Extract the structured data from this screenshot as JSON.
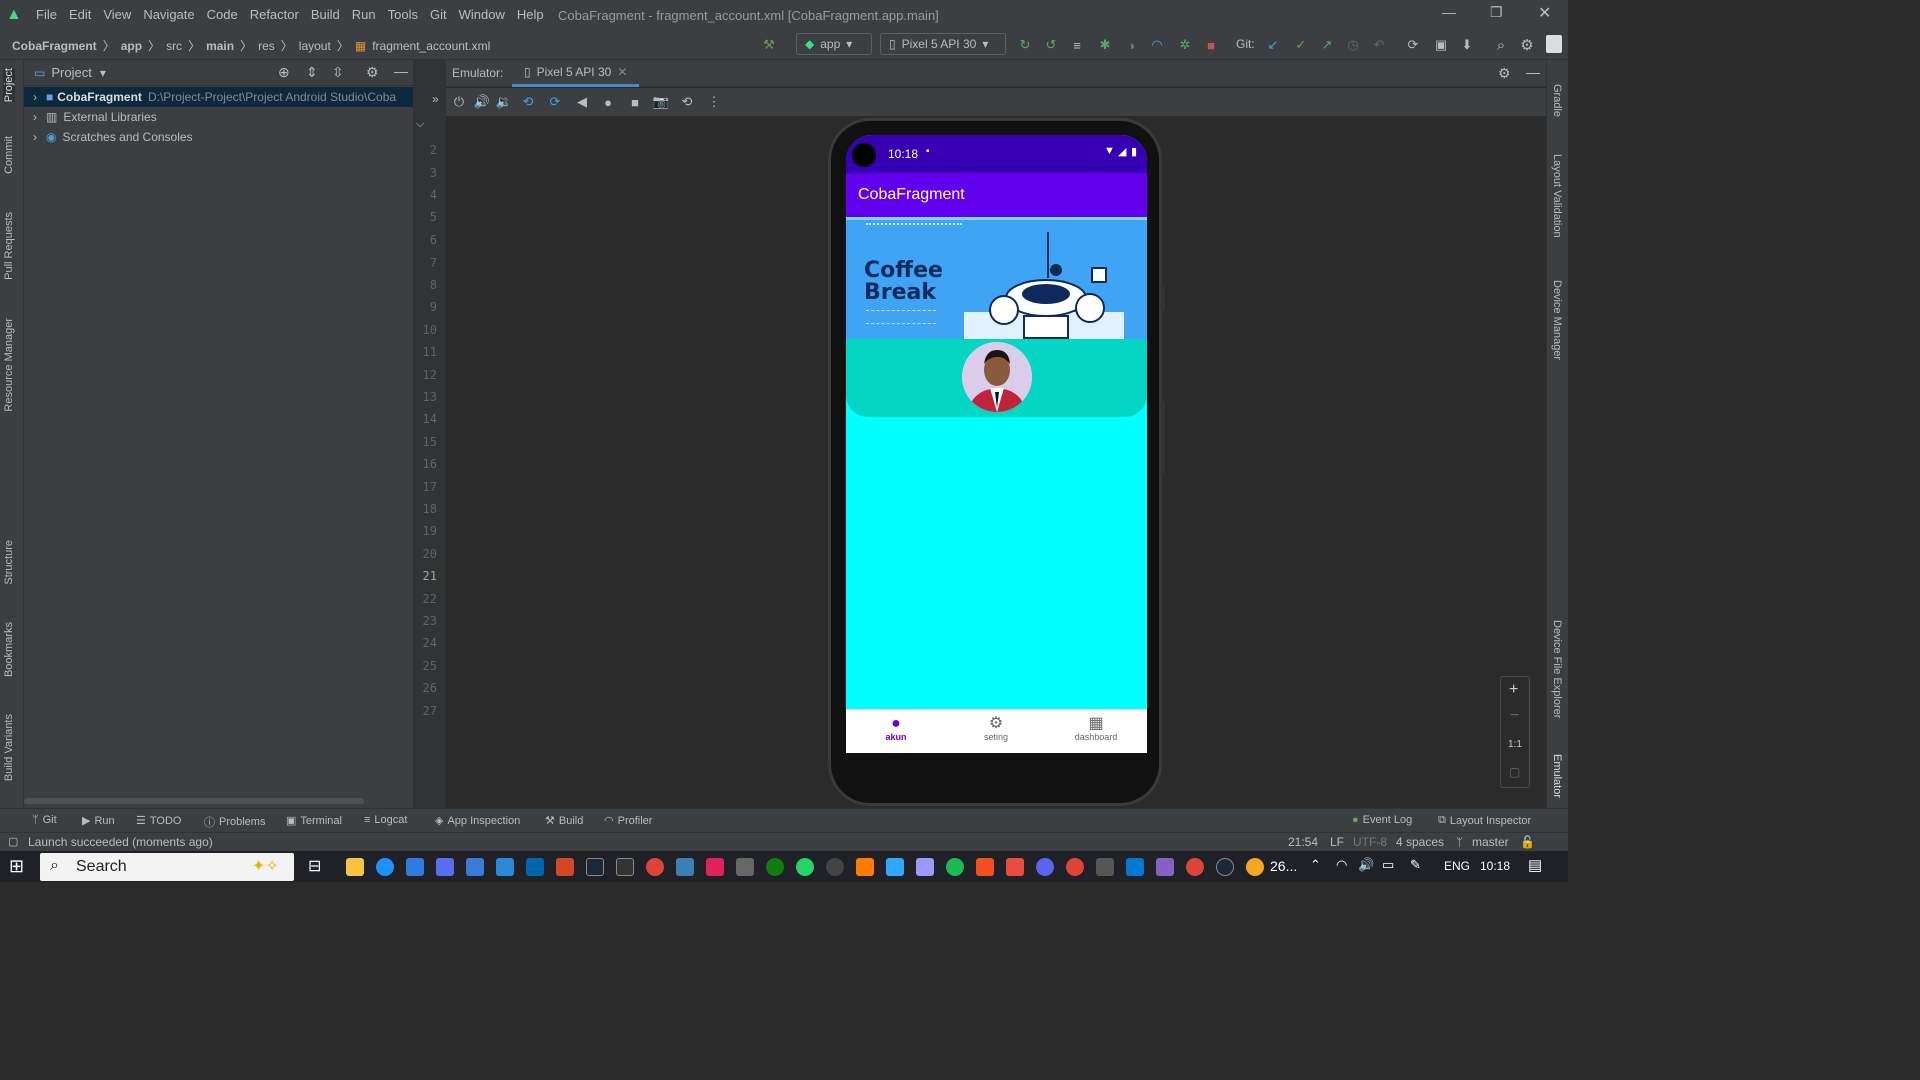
{
  "window": {
    "title": "CobaFragment - fragment_account.xml [CobaFragment.app.main]",
    "menu": [
      "File",
      "Edit",
      "View",
      "Navigate",
      "Code",
      "Refactor",
      "Build",
      "Run",
      "Tools",
      "Git",
      "Window",
      "Help"
    ]
  },
  "breadcrumb": [
    "CobaFragment",
    "app",
    "src",
    "main",
    "res",
    "layout",
    "fragment_account.xml"
  ],
  "toolbar": {
    "run_config": "app",
    "device": "Pixel 5 API 30",
    "git_label": "Git:"
  },
  "project_panel": {
    "title": "Project",
    "items": [
      {
        "label": "CobaFragment",
        "path": "D:\\Project-Project\\Project Android Studio\\Coba"
      },
      {
        "label": "External Libraries"
      },
      {
        "label": "Scratches and Consoles"
      }
    ]
  },
  "left_tabs": [
    "Project",
    "Commit",
    "Pull Requests",
    "Resource Manager",
    "Structure",
    "Bookmarks",
    "Build Variants"
  ],
  "right_tabs": [
    "Gradle",
    "Layout Validation",
    "Device Manager",
    "Device File Explorer",
    "Emulator"
  ],
  "gutter_lines": [
    "2",
    "3",
    "4",
    "5",
    "6",
    "7",
    "8",
    "9",
    "10",
    "11",
    "12",
    "13",
    "14",
    "15",
    "16",
    "17",
    "18",
    "19",
    "20",
    "21",
    "22",
    "23",
    "24",
    "25",
    "26",
    "27"
  ],
  "emulator": {
    "label": "Emulator:",
    "tab": "Pixel 5 API 30",
    "zoom_ratio": "1:1"
  },
  "phone": {
    "time": "10:18",
    "app_title": "CobaFragment",
    "banner_line1": "Coffee",
    "banner_line2": "Break",
    "nav": [
      {
        "label": "akun",
        "icon": "account-circle-icon",
        "active": true
      },
      {
        "label": "seting",
        "icon": "gear-icon",
        "active": false
      },
      {
        "label": "dashboard",
        "icon": "dashboard-icon",
        "active": false
      }
    ]
  },
  "bottom_tools": [
    "Git",
    "Run",
    "TODO",
    "Problems",
    "Terminal",
    "Logcat",
    "App Inspection",
    "Build",
    "Profiler"
  ],
  "bottom_tools_right": [
    "Event Log",
    "Layout Inspector"
  ],
  "status": {
    "message": "Launch succeeded (moments ago)",
    "position": "21:54",
    "line_sep": "LF",
    "encoding": "UTF-8",
    "indent": "4 spaces",
    "branch": "master"
  },
  "taskbar": {
    "search": "Search",
    "weather": "26...",
    "lang": "ENG",
    "clock": "10:18"
  },
  "colors": {
    "ide_bg": "#2b2b2b",
    "panel_bg": "#3c3f41",
    "status_bar": "#3700b3",
    "app_bar": "#6200ee",
    "screen_bg": "#00ffff",
    "header_card": "#05d6c3",
    "banner": "#3fa4f3"
  }
}
